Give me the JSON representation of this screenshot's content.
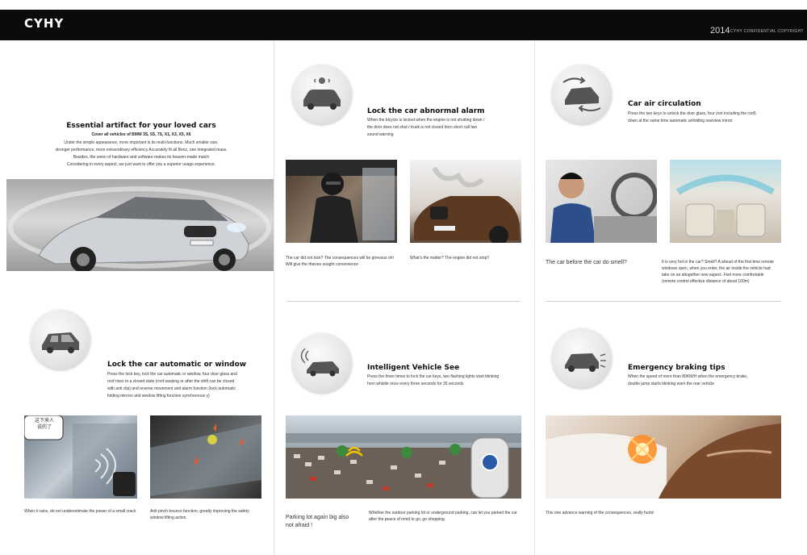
{
  "header": {
    "logo": "CYHY",
    "year": "2014",
    "confidential": "CYHY CONFIDENTIAL COPYRIGHT"
  },
  "intro": {
    "title": "Essential artifact for your loved cars",
    "subtitle": "Cover all vehicles of BMW 3S, 5S, 7S, X1, X3, X5, X6",
    "lines": [
      "Under the simple appearance, more important is its multi-functions. Much smaller size,",
      "stronger performance, more extraordinary efficiency Accurately fit all Benz, one integrated mass.",
      "Besides, the union of hardware and software makes its heaven-made match",
      "Considering in every aspect, we just want to offer you a superior usage experience."
    ]
  },
  "abnormal_alarm": {
    "title": "Lock the car abnormal alarm",
    "lines": [
      "When the bicycle is locked when the engine is not shutting down /",
      "the door does not shut / trunk is not closed horn short call two",
      "sound warning"
    ],
    "caption_left": [
      "The car did not lock? The consequences will be grievous oh!",
      "Will give the thieves sought convenience"
    ],
    "caption_right": "What's the matter? The engine did not stop!!"
  },
  "air_circulation": {
    "title": "Car air circulation",
    "lines": [
      "Press the two keys to unlock the door glass, four (not including the roof)",
      "down at the same time automatic unfolding rearview mirror"
    ],
    "caption_left": "The car before the car do smell?",
    "caption_right": [
      "It is very hot in the car? Smell? A ahead of the first time remote",
      "windows open, when you enter, the air inside the vehicle had",
      "take on an altogether new aspect. Feel more comfortable",
      "(remote control effective distance of about 100m)"
    ]
  },
  "lock_window": {
    "title": "Lock the car automatic or window",
    "lines": [
      "Press the lock key, lock the car automatic or window, four door glass and",
      "roof rises to a closed state (roof warping or after the shift can be closed",
      "with anti clip) and reverse movement and alarm function (lock automatic",
      "folding mirrors and window lifting function synchronous y)"
    ],
    "sticker": [
      "这下来人",
      "说的了"
    ],
    "caption_left": "When it rains, do not underestimate the power of a small crack",
    "caption_right": [
      "Anti pinch bounce function, greatly improving the safety",
      "window lifting action."
    ]
  },
  "vehicle_see": {
    "title": "Intelligent Vehicle See",
    "lines": [
      "Press the three times to lock the car keys, two flashing lights start blinking",
      "horn whistle once every three seconds for 30 seconds"
    ],
    "caption_left": [
      "Parking lot again big also",
      "not afraid !"
    ],
    "caption_right": [
      "Whether the outdoor parking lot or underground parking, can let you parked the car",
      "after the peace of mind to go, go shopping."
    ]
  },
  "braking": {
    "title": "Emergency braking tips",
    "lines": [
      "When the speed of more than 80KM/H when the emergency brake,",
      "double jump starts blinking warn the rear vehicle"
    ],
    "caption": "This one advance warning of the consequences, really hurts!"
  },
  "icons": {
    "alarm": "car-alarm-icon",
    "air": "air-circulation-icon",
    "window": "car-window-icon",
    "see": "car-signal-icon",
    "brake": "car-brake-icon"
  },
  "colors": {
    "header_bg": "#0b0b0b",
    "circle_bg": "#e6e6e6",
    "brake_light": "#ff8a1e"
  }
}
